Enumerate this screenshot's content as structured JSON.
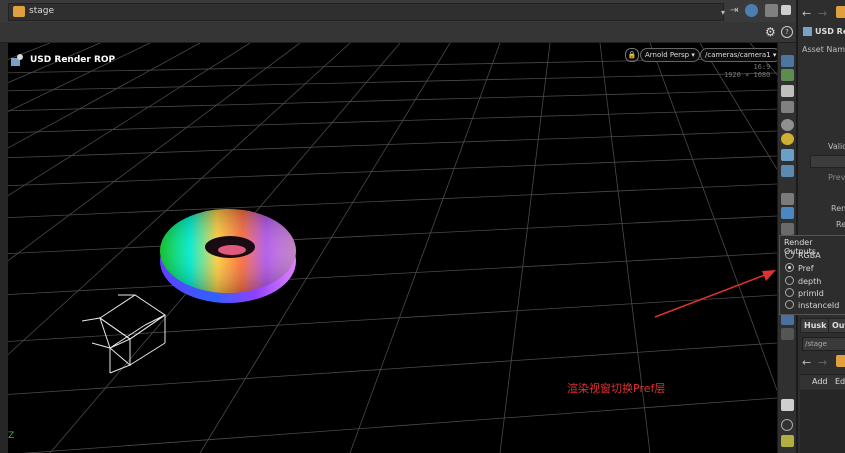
{
  "top_bar": {
    "path_label": "stage",
    "path_dropdown": "▾"
  },
  "viewport": {
    "title": "USD Render ROP",
    "camera_menu": "Arnold Persp ▾",
    "camera_path": "/cameras/camera1 ▾",
    "resolution_top": "16:9",
    "resolution": "1920 × 1080",
    "axis_label": "Z"
  },
  "right_panel": {
    "node_title": "USD Rend",
    "asset_name_label": "Asset Name",
    "valid_label": "Valid",
    "preview_label": "Previe",
    "render_label_1": "Rend",
    "render_label_2": "Re",
    "tab_husk": "Husk",
    "tab_outputs": "Outp",
    "stage_field": "/stage",
    "add_label": "Add",
    "edit_label": "Edi"
  },
  "render_outputs_popup": {
    "title": "Render Outputs",
    "options": [
      "RGBA",
      "Pref",
      "depth",
      "primId",
      "instanceId"
    ],
    "selected": "Pref"
  },
  "annotation": {
    "text": "渲染视窗切换Pref层",
    "color": "#e03030"
  }
}
